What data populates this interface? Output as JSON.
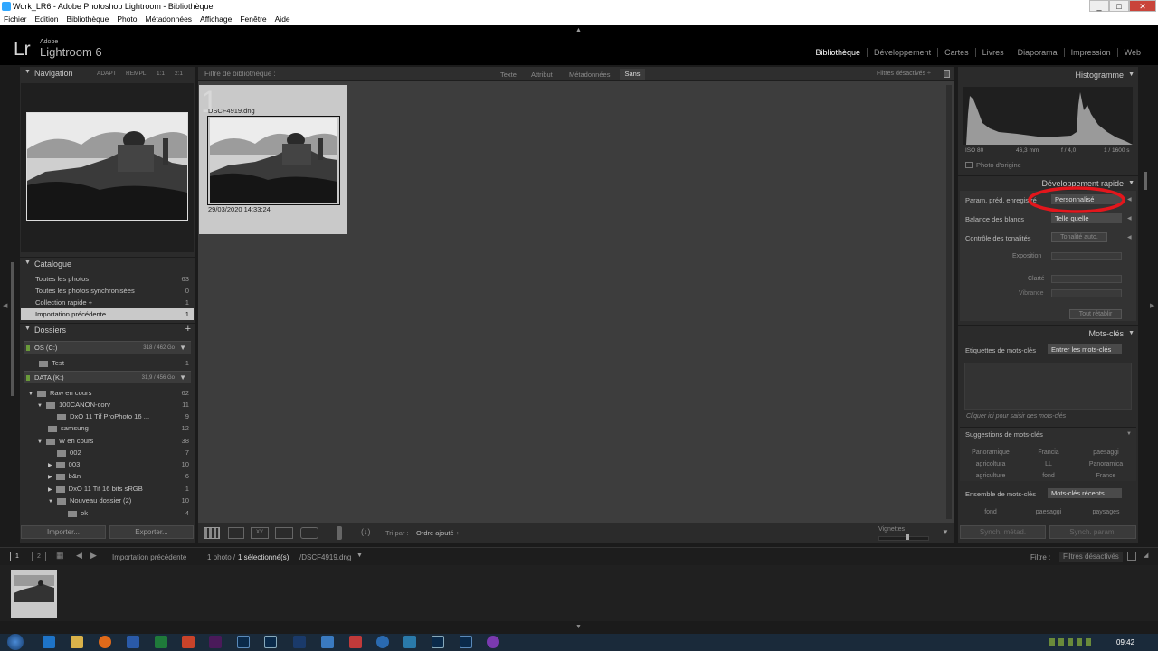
{
  "window": {
    "title": "Work_LR6 - Adobe Photoshop Lightroom - Bibliothèque",
    "min": "_",
    "max": "□",
    "close": "✕"
  },
  "menu": [
    "Fichier",
    "Edition",
    "Bibliothèque",
    "Photo",
    "Métadonnées",
    "Affichage",
    "Fenêtre",
    "Aide"
  ],
  "brand": {
    "lr": "Lr",
    "adobe": "Adobe",
    "name": "Lightroom 6"
  },
  "modules": [
    "Bibliothèque",
    "Développement",
    "Cartes",
    "Livres",
    "Diaporama",
    "Impression",
    "Web"
  ],
  "navigation": {
    "title": "Navigation",
    "zoom": [
      "ADAPT",
      "REMPL.",
      "1:1",
      "2:1"
    ]
  },
  "catalog": {
    "title": "Catalogue",
    "items": [
      {
        "label": "Toutes les photos",
        "count": "63"
      },
      {
        "label": "Toutes les photos synchronisées",
        "count": "0"
      },
      {
        "label": "Collection rapide +",
        "count": "1"
      },
      {
        "label": "Importation précédente",
        "count": "1"
      }
    ]
  },
  "folders": {
    "title": "Dossiers",
    "add": "+",
    "vol1": {
      "name": "OS (C:)",
      "size": "318 / 462 Go"
    },
    "vol1_items": [
      {
        "label": "Test",
        "count": "1"
      }
    ],
    "vol2": {
      "name": "DATA (K:)",
      "size": "31,9 / 456 Go"
    },
    "vol2_items": [
      {
        "label": "Raw en cours",
        "count": "62"
      },
      {
        "label": "100CANON-corv",
        "count": "11"
      },
      {
        "label": "DxO 11 Tif ProPhoto 16 ...",
        "count": "9"
      },
      {
        "label": "samsung",
        "count": "12"
      },
      {
        "label": "W en cours",
        "count": "38"
      },
      {
        "label": "002",
        "count": "7"
      },
      {
        "label": "003",
        "count": "10"
      },
      {
        "label": "b&n",
        "count": "6"
      },
      {
        "label": "DxO 11 Tif 16 bits sRGB",
        "count": "1"
      },
      {
        "label": "Nouveau dossier (2)",
        "count": "10"
      },
      {
        "label": "ok",
        "count": "4"
      }
    ]
  },
  "left_buttons": {
    "import": "Importer...",
    "export": "Exporter..."
  },
  "filter": {
    "label": "Filtre de bibliothèque :",
    "tabs": [
      "Texte",
      "Attribut",
      "Métadonnées",
      "Sans"
    ],
    "status": "Filtres désactivés ÷"
  },
  "grid": {
    "index": "1",
    "filename": "DSCF4919.dng",
    "date": "29/03/2020 14:33:24"
  },
  "toolbar": {
    "sort_label": "Tri par :",
    "sort_value": "Ordre ajouté ÷",
    "thumbs": "Vignettes"
  },
  "histogram": {
    "title": "Histogramme",
    "iso": "ISO 80",
    "focal": "46,3 mm",
    "aperture": "f / 4,0",
    "shutter": "1 / 1600 s",
    "original": "Photo d'origine"
  },
  "quick_dev": {
    "title": "Développement rapide",
    "preset_label": "Param. préd. enregistré",
    "preset_value": "Personnalisé",
    "wb_label": "Balance des blancs",
    "wb_value": "Telle quelle",
    "tone_label": "Contrôle des tonalités",
    "auto_tone": "Tonalité auto.",
    "exposure": "Exposition",
    "clarity": "Clarté",
    "vibrance": "Vibrance",
    "reset": "Tout rétablir",
    "highlight_color": "#e3161c"
  },
  "keywords": {
    "title": "Mots-clés",
    "tags_label": "Etiquettes de mots-clés",
    "tags_value": "Entrer les mots-clés",
    "hint": "Cliquer ici pour saisir des mots-clés",
    "suggestions_title": "Suggestions de mots-clés",
    "suggestions": [
      "Panoramique",
      "Francia",
      "paesaggi",
      "agricoltura",
      "LL",
      "Panoramica",
      "agriculture",
      "fond",
      "France"
    ],
    "set_label": "Ensemble de mots-clés",
    "set_value": "Mots-clés récents",
    "set_items": [
      "fond",
      "paesaggi",
      "paysages"
    ]
  },
  "right_buttons": {
    "sync_meta": "Synch. métad.",
    "sync_settings": "Synch. param."
  },
  "filmstrip": {
    "pages": [
      "1",
      "2"
    ],
    "source": "Importation précédente",
    "info_pre": "1 photo /",
    "info_sel": "1 sélectionné(s)",
    "info_post": "/DSCF4919.dng",
    "filter_label": "Filtre :",
    "filter_value": "Filtres désactivés"
  },
  "taskbar": {
    "time": "09:42"
  }
}
